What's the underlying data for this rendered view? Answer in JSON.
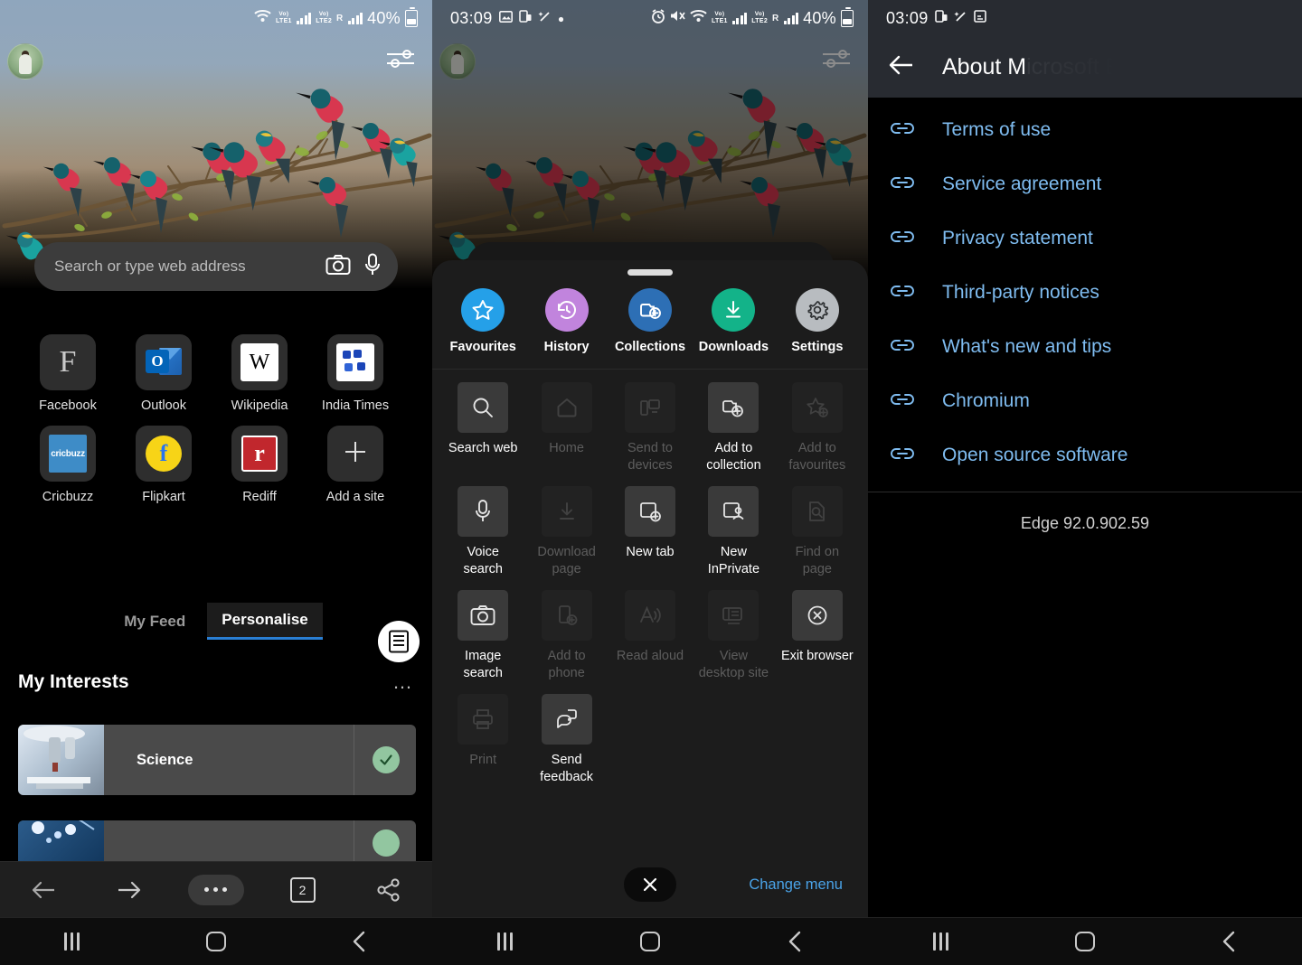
{
  "panel1": {
    "status": {
      "icons": [
        "wifi-icon",
        "volte1-icon",
        "signal1-icon",
        "volte2-icon",
        "roaming-icon",
        "signal2-icon"
      ],
      "battery": "40%"
    },
    "avatar_name": "profile-avatar",
    "search": {
      "placeholder": "Search or type web address",
      "camera_icon": "camera-icon",
      "mic_icon": "microphone-icon"
    },
    "shortcuts": [
      {
        "label": "Facebook",
        "icon": "facebook-icon"
      },
      {
        "label": "Outlook",
        "icon": "outlook-icon"
      },
      {
        "label": "Wikipedia",
        "icon": "wikipedia-icon"
      },
      {
        "label": "India Times",
        "icon": "india-times-icon"
      },
      {
        "label": "Cricbuzz",
        "icon": "cricbuzz-icon"
      },
      {
        "label": "Flipkart",
        "icon": "flipkart-icon"
      },
      {
        "label": "Rediff",
        "icon": "rediff-icon"
      },
      {
        "label": "Add a site",
        "icon": "plus-icon"
      }
    ],
    "tabs": [
      {
        "label": "My Feed",
        "active": false
      },
      {
        "label": "Personalise",
        "active": true
      }
    ],
    "section_title": "My Interests",
    "overflow": "…",
    "interests": [
      {
        "label": "Science",
        "selected": true
      },
      {
        "label": "",
        "selected": true
      }
    ],
    "toolbar": {
      "back": "back-arrow-icon",
      "forward": "forward-arrow-icon",
      "menu": "more-options-icon",
      "tab_count": "2",
      "share": "share-icon"
    }
  },
  "panel2": {
    "status": {
      "time": "03:09",
      "left_icons": [
        "image-icon",
        "screen-record-icon",
        "magic-wand-icon",
        "dot-icon"
      ],
      "right_icons": [
        "alarm-icon",
        "mute-icon",
        "wifi-icon",
        "volte1-icon",
        "signal1-icon",
        "volte2-icon",
        "roaming-icon",
        "signal2-icon"
      ],
      "battery": "40%"
    },
    "quick_actions": [
      {
        "label": "Favourites",
        "icon": "star-icon",
        "color": "#25a0e8"
      },
      {
        "label": "History",
        "icon": "history-clock-icon",
        "color": "#c184dd"
      },
      {
        "label": "Collections",
        "icon": "collections-icon",
        "color": "#2d6fb5"
      },
      {
        "label": "Downloads",
        "icon": "download-icon",
        "color": "#13b389"
      },
      {
        "label": "Settings",
        "icon": "gear-icon",
        "color": "#b8bcc0"
      }
    ],
    "menu_grid": [
      {
        "label": "Search web",
        "icon": "search-icon",
        "enabled": true
      },
      {
        "label": "Home",
        "icon": "home-icon",
        "enabled": false
      },
      {
        "label": "Send to devices",
        "icon": "send-to-devices-icon",
        "enabled": false
      },
      {
        "label": "Add to collection",
        "icon": "add-to-collection-icon",
        "enabled": true
      },
      {
        "label": "Add to favourites",
        "icon": "add-to-favourites-icon",
        "enabled": false
      },
      {
        "label": "Voice search",
        "icon": "microphone-icon",
        "enabled": true
      },
      {
        "label": "Download page",
        "icon": "download-icon",
        "enabled": false
      },
      {
        "label": "New tab",
        "icon": "new-tab-icon",
        "enabled": true
      },
      {
        "label": "New InPrivate",
        "icon": "inprivate-icon",
        "enabled": true
      },
      {
        "label": "Find on page",
        "icon": "find-on-page-icon",
        "enabled": false
      },
      {
        "label": "Image search",
        "icon": "camera-icon",
        "enabled": true
      },
      {
        "label": "Add to phone",
        "icon": "add-to-phone-icon",
        "enabled": false
      },
      {
        "label": "Read aloud",
        "icon": "read-aloud-icon",
        "enabled": false
      },
      {
        "label": "View desktop site",
        "icon": "desktop-site-icon",
        "enabled": false
      },
      {
        "label": "Exit browser",
        "icon": "exit-icon",
        "enabled": true
      },
      {
        "label": "Print",
        "icon": "printer-icon",
        "enabled": false
      },
      {
        "label": "Send feedback",
        "icon": "feedback-icon",
        "enabled": true
      }
    ],
    "close_label": "close-icon",
    "change_menu": "Change menu"
  },
  "panel3": {
    "status": {
      "time": "03:09",
      "left_icons": [
        "screen-record-icon",
        "magic-wand-icon",
        "save-icon"
      ]
    },
    "back_icon": "back-arrow-icon",
    "title": "About M",
    "title_fade": "icrosoft Edge",
    "links": [
      {
        "label": "Terms of use",
        "icon": "link-icon"
      },
      {
        "label": "Service agreement",
        "icon": "link-icon"
      },
      {
        "label": "Privacy statement",
        "icon": "link-icon"
      },
      {
        "label": "Third-party notices",
        "icon": "link-icon"
      },
      {
        "label": "What's new and tips",
        "icon": "link-icon"
      },
      {
        "label": "Chromium",
        "icon": "link-icon"
      },
      {
        "label": "Open source software",
        "icon": "link-icon"
      }
    ],
    "version": "Edge 92.0.902.59",
    "link_color": "#7fbcf0"
  },
  "navbar": {
    "recents": "recents-icon",
    "home": "home-icon",
    "back": "back-icon"
  }
}
